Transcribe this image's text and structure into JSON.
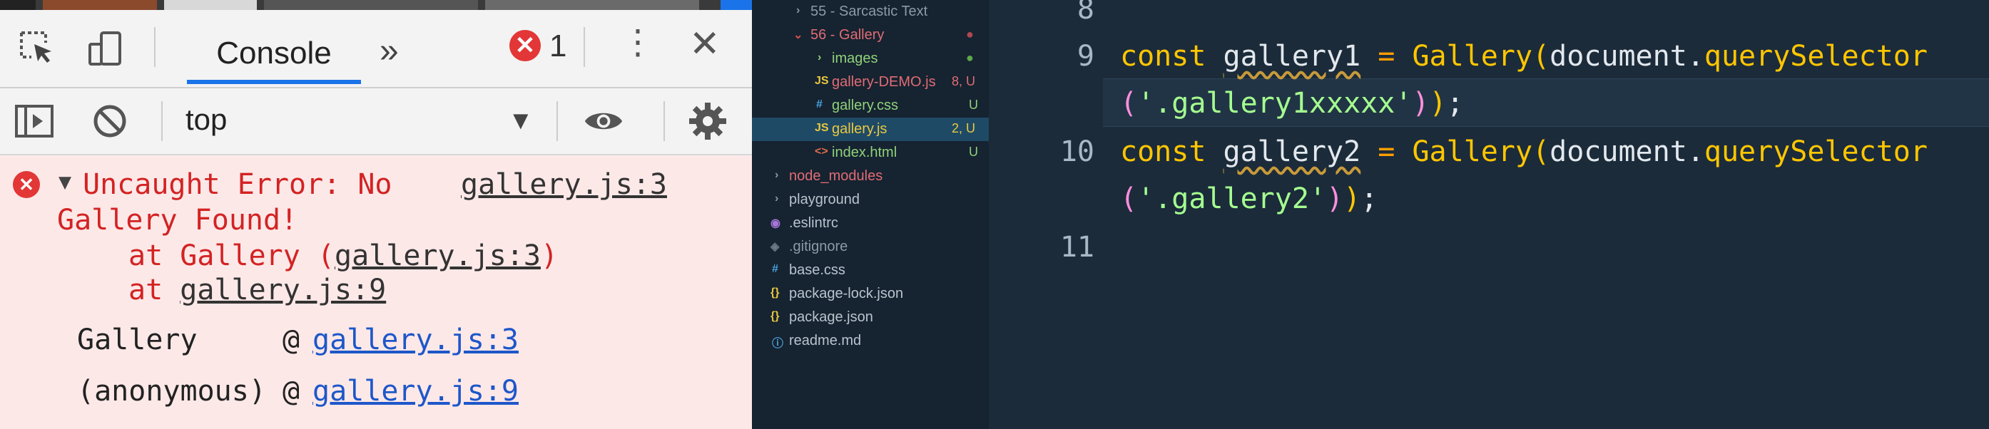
{
  "devtools": {
    "tabs": {
      "console_label": "Console",
      "more_tabs": "»"
    },
    "error_count": "1",
    "context": "top",
    "console": {
      "error_line1": "Uncaught Error: No",
      "error_source": "gallery.js:3",
      "error_line2": "Gallery Found!",
      "stack": [
        {
          "prefix": "at Gallery (",
          "link": "gallery.js:3",
          "suffix": ")"
        },
        {
          "prefix": "at ",
          "link": "gallery.js:9",
          "suffix": ""
        }
      ],
      "frames": [
        {
          "name": "Gallery",
          "at": "@",
          "link": "gallery.js:3"
        },
        {
          "name": "(anonymous)",
          "at": "@",
          "link": "gallery.js:9"
        }
      ]
    }
  },
  "explorer": {
    "items": [
      {
        "label": "55 - Sarcastic Text",
        "type": "folder",
        "badge": ""
      },
      {
        "label": "56 - Gallery",
        "type": "folder-open",
        "badge": "●"
      },
      {
        "label": "images",
        "type": "folder",
        "badge": "●"
      },
      {
        "label": "gallery-DEMO.js",
        "type": "js",
        "badge": "8, U"
      },
      {
        "label": "gallery.css",
        "type": "css",
        "badge": "U"
      },
      {
        "label": "gallery.js",
        "type": "js",
        "badge": "2, U"
      },
      {
        "label": "index.html",
        "type": "html",
        "badge": "U"
      },
      {
        "label": "node_modules",
        "type": "folder",
        "badge": ""
      },
      {
        "label": "playground",
        "type": "folder",
        "badge": ""
      },
      {
        "label": ".eslintrc",
        "type": "eslint",
        "badge": ""
      },
      {
        "label": ".gitignore",
        "type": "git",
        "badge": ""
      },
      {
        "label": "base.css",
        "type": "css",
        "badge": ""
      },
      {
        "label": "package-lock.json",
        "type": "json",
        "badge": ""
      },
      {
        "label": "package.json",
        "type": "json",
        "badge": ""
      },
      {
        "label": "readme.md",
        "type": "md",
        "badge": ""
      }
    ]
  },
  "editor": {
    "line_numbers": [
      "8",
      "9",
      "10",
      "11"
    ],
    "line9": {
      "kw": "const",
      "var": "gallery1",
      "eq": "=",
      "fn": "Gallery",
      "open": "(",
      "obj": "document",
      "dot": ".",
      "method": "querySelector",
      "cont_open": "(",
      "str": "'.gallery1xxxxx'",
      "cont_close": ")",
      "close": ")",
      "semi": ";"
    },
    "line10": {
      "kw": "const",
      "var": "gallery2",
      "eq": "=",
      "fn": "Gallery",
      "open": "(",
      "obj": "document",
      "dot": ".",
      "method": "querySelector",
      "cont_open": "(",
      "str": "'.gallery2'",
      "cont_close": ")",
      "close": ")",
      "semi": ";"
    }
  }
}
